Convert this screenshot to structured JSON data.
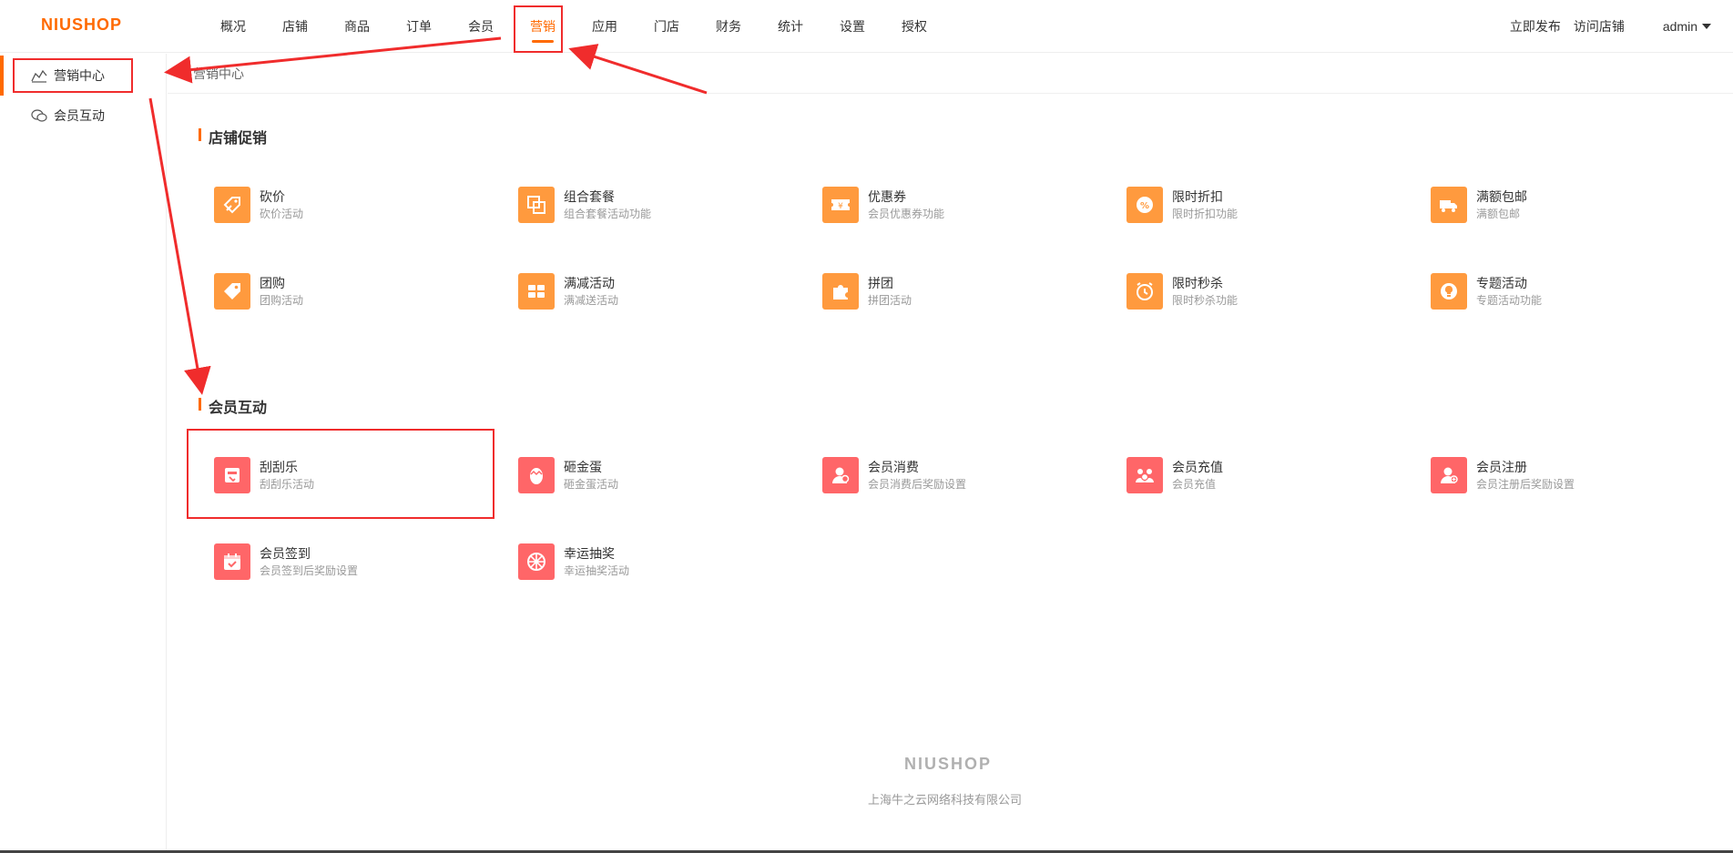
{
  "header": {
    "logo": "NIUSHOP",
    "nav": [
      "概况",
      "店铺",
      "商品",
      "订单",
      "会员",
      "营销",
      "应用",
      "门店",
      "财务",
      "统计",
      "设置",
      "授权"
    ],
    "active_nav": "营销",
    "publish": "立即发布",
    "visit_store": "访问店铺",
    "user": "admin"
  },
  "sidebar": {
    "items": [
      {
        "label": "营销中心",
        "icon": "chart-icon"
      },
      {
        "label": "会员互动",
        "icon": "chat-icon"
      }
    ]
  },
  "breadcrumb": "营销中心",
  "sections": [
    {
      "title": "店铺促销",
      "cards": [
        {
          "name": "砍价",
          "desc": "砍价活动",
          "icon": "bargain-tag-icon"
        },
        {
          "name": "组合套餐",
          "desc": "组合套餐活动功能",
          "icon": "combo-icon"
        },
        {
          "name": "优惠券",
          "desc": "会员优惠券功能",
          "icon": "coupon-icon"
        },
        {
          "name": "限时折扣",
          "desc": "限时折扣功能",
          "icon": "percent-icon"
        },
        {
          "name": "满额包邮",
          "desc": "满额包邮",
          "icon": "truck-icon"
        },
        {
          "name": "团购",
          "desc": "团购活动",
          "icon": "tag-icon"
        },
        {
          "name": "满减活动",
          "desc": "满减送活动",
          "icon": "gift-icon"
        },
        {
          "name": "拼团",
          "desc": "拼团活动",
          "icon": "puzzle-icon"
        },
        {
          "name": "限时秒杀",
          "desc": "限时秒杀功能",
          "icon": "alarm-icon"
        },
        {
          "name": "专题活动",
          "desc": "专题活动功能",
          "icon": "bulb-icon"
        }
      ]
    },
    {
      "title": "会员互动",
      "cards": [
        {
          "name": "刮刮乐",
          "desc": "刮刮乐活动",
          "icon": "scratch-icon"
        },
        {
          "name": "砸金蛋",
          "desc": "砸金蛋活动",
          "icon": "egg-icon"
        },
        {
          "name": "会员消费",
          "desc": "会员消费后奖励设置",
          "icon": "member-consume-icon"
        },
        {
          "name": "会员充值",
          "desc": "会员充值",
          "icon": "member-recharge-icon"
        },
        {
          "name": "会员注册",
          "desc": "会员注册后奖励设置",
          "icon": "member-register-icon"
        },
        {
          "name": "会员签到",
          "desc": "会员签到后奖励设置",
          "icon": "calendar-check-icon"
        },
        {
          "name": "幸运抽奖",
          "desc": "幸运抽奖活动",
          "icon": "wheel-icon"
        }
      ]
    }
  ],
  "footer": {
    "logo": "NIUSHOP",
    "company": "上海牛之云网络科技有限公司"
  },
  "colors": {
    "accent": "#ff6a00",
    "promo_icon": "#ff9a3e",
    "member_icon": "#ff6668",
    "annotation": "#f02c2c"
  }
}
